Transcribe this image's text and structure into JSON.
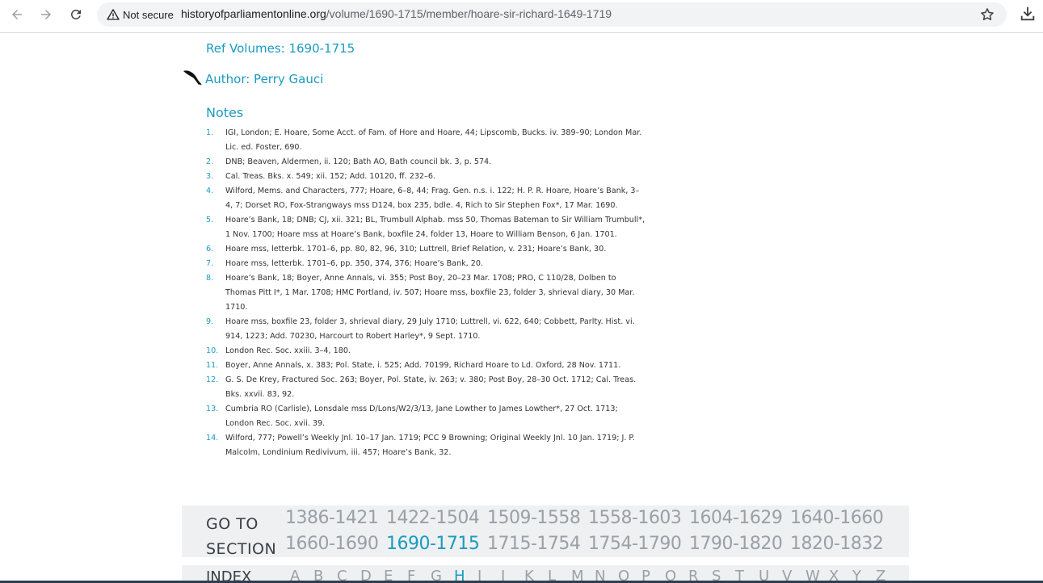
{
  "browser": {
    "security_label": "Not secure",
    "url_host": "historyofparliamentonline.org",
    "url_path": "/volume/1690-1715/member/hoare-sir-richard-1649-1719"
  },
  "page": {
    "ref_volumes": "Ref Volumes: 1690-1715",
    "author": "Author: Perry Gauci",
    "notes_title": "Notes",
    "notes": [
      {
        "num": "1.",
        "text": "IGI, London; E. Hoare, Some Acct. of Fam. of Hore and Hoare, 44; Lipscomb, Bucks. iv. 389–90; London Mar. Lic. ed. Foster, 690."
      },
      {
        "num": "2.",
        "text": "DNB; Beaven, Aldermen, ii. 120; Bath AO, Bath council bk. 3, p. 574."
      },
      {
        "num": "3.",
        "text": "Cal. Treas. Bks. x. 549; xii. 152; Add. 10120, ff. 232–6."
      },
      {
        "num": "4.",
        "text": "Wilford, Mems. and Characters, 777; Hoare, 6–8, 44; Frag. Gen. n.s. i. 122; H. P. R. Hoare, Hoare’s Bank, 3–4, 7; Dorset RO, Fox-Strangways mss D124, box 235, bdle. 4, Rich to Sir Stephen Fox*, 17 Mar. 1690."
      },
      {
        "num": "5.",
        "text": "Hoare’s Bank, 18; DNB; CJ, xii. 321; BL, Trumbull Alphab. mss 50, Thomas Bateman to Sir William Trumbull*, 1 Nov. 1700; Hoare mss at Hoare’s Bank, boxfile 24, folder 13, Hoare to William Benson, 6 Jan. 1701."
      },
      {
        "num": "6.",
        "text": "Hoare mss, letterbk. 1701–6, pp. 80, 82, 96, 310; Luttrell, Brief Relation, v. 231; Hoare’s Bank, 30."
      },
      {
        "num": "7.",
        "text": "Hoare mss, letterbk. 1701–6, pp. 350, 374, 376; Hoare’s Bank, 20."
      },
      {
        "num": "8.",
        "text": "Hoare’s Bank, 18; Boyer, Anne Annals, vi. 355; Post Boy, 20–23 Mar. 1708; PRO, C 110/28, Dolben to Thomas Pitt I*, 1 Mar. 1708; HMC Portland, iv. 507; Hoare mss, boxfile 23, folder 3, shrieval diary, 30 Mar. 1710."
      },
      {
        "num": "9.",
        "text": "Hoare mss, boxfile 23, folder 3, shrieval diary, 29 July 1710; Luttrell, vi. 622, 640; Cobbett, Parlty. Hist. vi. 914, 1223; Add. 70230, Harcourt to Robert Harley*, 9 Sept. 1710."
      },
      {
        "num": "10.",
        "text": "London Rec. Soc. xxiii. 3–4, 180."
      },
      {
        "num": "11.",
        "text": "Boyer, Anne Annals, x. 383; Pol. State, i. 525; Add. 70199, Richard Hoare to Ld. Oxford, 28 Nov. 1711."
      },
      {
        "num": "12.",
        "text": "G. S. De Krey, Fractured Soc. 263; Boyer, Pol. State, iv. 263; v. 380; Post Boy, 28–30 Oct. 1712; Cal. Treas. Bks. xxvii. 83, 92."
      },
      {
        "num": "13.",
        "text": "Cumbria RO (Carlisle), Lonsdale mss D/Lons/W2/3/13, Jane Lowther to James Lowther*, 27 Oct. 1713; London Rec. Soc. xvii. 39."
      },
      {
        "num": "14.",
        "text": "Wilford, 777; Powell’s Weekly Jnl. 10–17 Jan. 1719; PCC 9 Browning; Original Weekly Jnl. 10 Jan. 1719; J. P. Malcolm, Londinium Redivivum, iii. 457; Hoare’s Bank, 32."
      }
    ]
  },
  "sections": {
    "goto_line1": "GO TO",
    "goto_line2": "SECTION",
    "periods": [
      "1386-1421",
      "1422-1504",
      "1509-1558",
      "1558-1603",
      "1604-1629",
      "1640-1660",
      "1660-1690",
      "1690-1715",
      "1715-1754",
      "1754-1790",
      "1790-1820",
      "1820-1832"
    ],
    "active_period": "1690-1715"
  },
  "index": {
    "label": "INDEX",
    "letters": [
      "A",
      "B",
      "C",
      "D",
      "E",
      "F",
      "G",
      "H",
      "I",
      "J",
      "K",
      "L",
      "M",
      "N",
      "O",
      "P",
      "Q",
      "R",
      "S",
      "T",
      "U",
      "V",
      "W",
      "X",
      "Y",
      "Z"
    ],
    "active_letter": "H"
  },
  "colors": {
    "accent": "#1a9bbf",
    "muted": "#9aa0a6",
    "panel": "#eef0f2"
  }
}
